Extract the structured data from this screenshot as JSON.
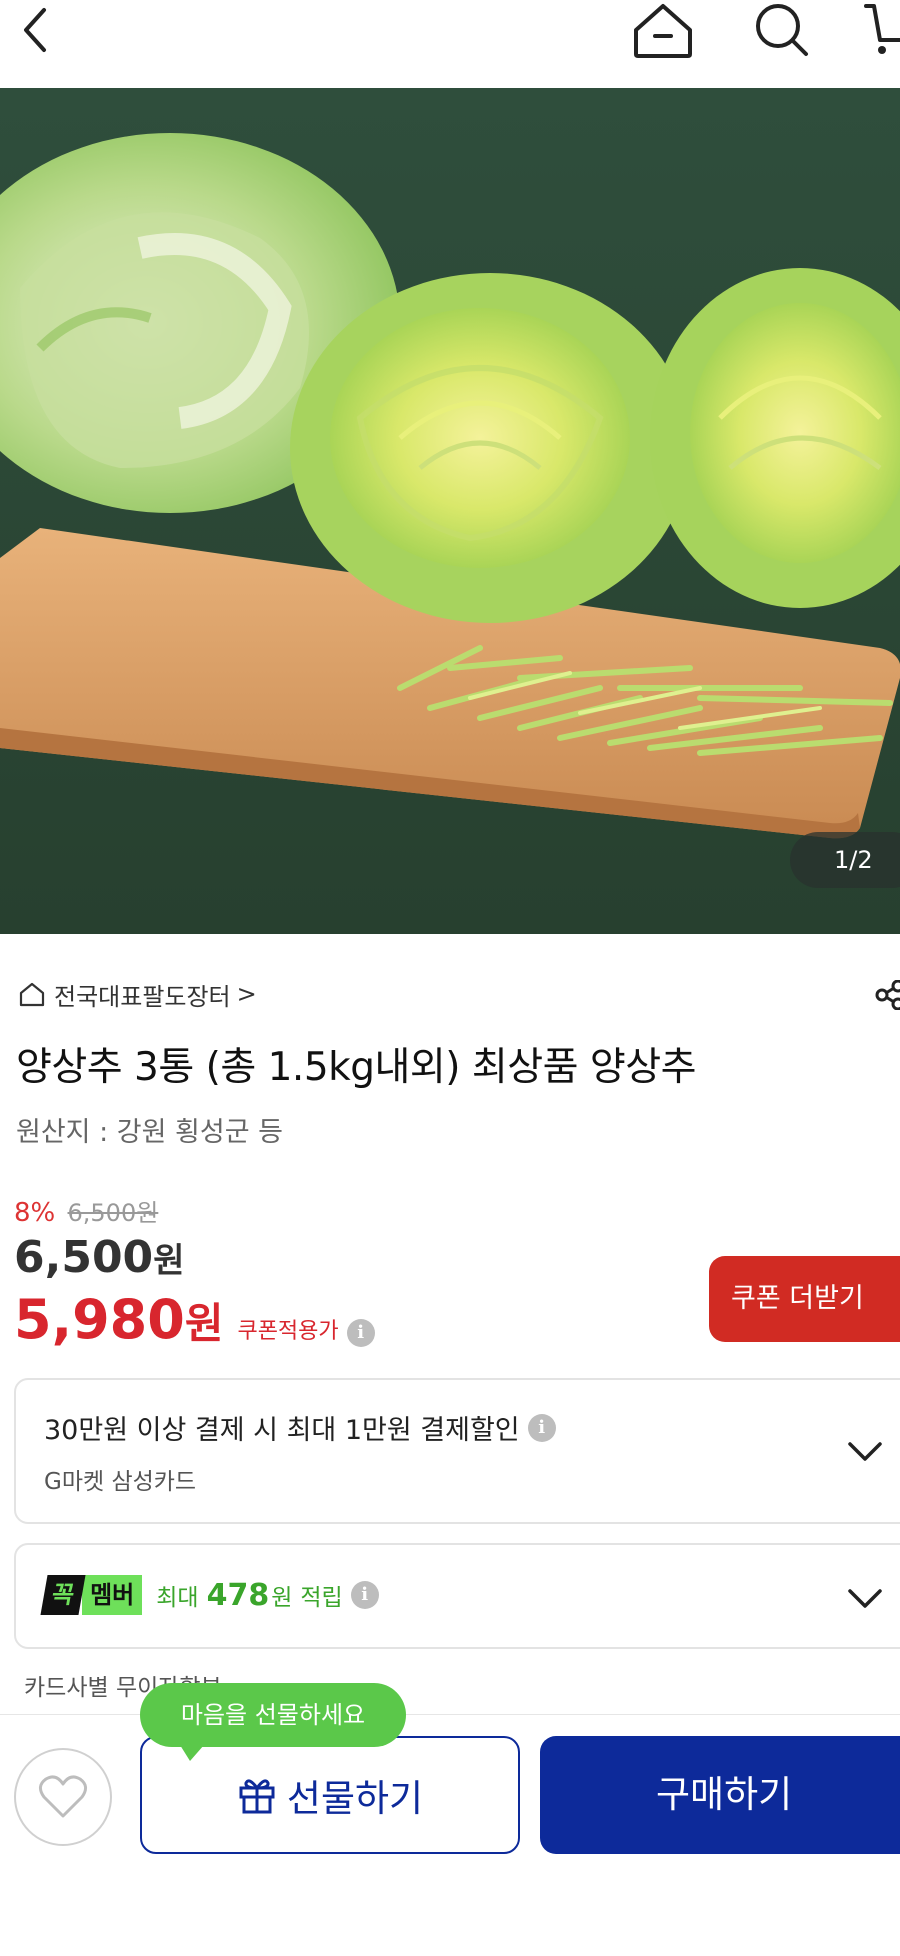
{
  "topbar": {
    "icons": [
      "back-arrow-icon",
      "home-icon",
      "search-icon",
      "cart-icon"
    ]
  },
  "hero": {
    "image": "iceberg lettuce on wooden cutting board",
    "pager": "1/2"
  },
  "store": {
    "name": "전국대표팔도장터",
    "chevron": ">"
  },
  "product": {
    "title": "양상추 3통 (총 1.5kg내외) 최상품 양상추",
    "origin": "원산지 : 강원 횡성군 등"
  },
  "pricing": {
    "discount_pct": "8%",
    "original_price": "6,500원",
    "price": "6,500",
    "price_unit": "원",
    "coupon_price": "5,980",
    "coupon_unit": "원",
    "coupon_label": "쿠폰적용가",
    "info_glyph": "i"
  },
  "coupon_button": {
    "label": "쿠폰 더받기"
  },
  "card_discount": {
    "title": "30만원 이상 결제 시 최대 1만원 결제할인",
    "subtitle": "G마켓 삼성카드"
  },
  "membership": {
    "badge_left": "꼭",
    "badge_right": "멤버",
    "prefix": "최대",
    "amount": "478",
    "unit": "원",
    "suffix": "적립"
  },
  "installment": {
    "text": "카드사별 무이자할부"
  },
  "bottom_bar": {
    "tooltip": "마음을 선물하세요",
    "gift_label": "선물하기",
    "buy_label": "구매하기"
  },
  "colors": {
    "accent_red": "#d8262e",
    "primary_blue": "#0d2a9a",
    "member_green": "#5bc84a"
  }
}
